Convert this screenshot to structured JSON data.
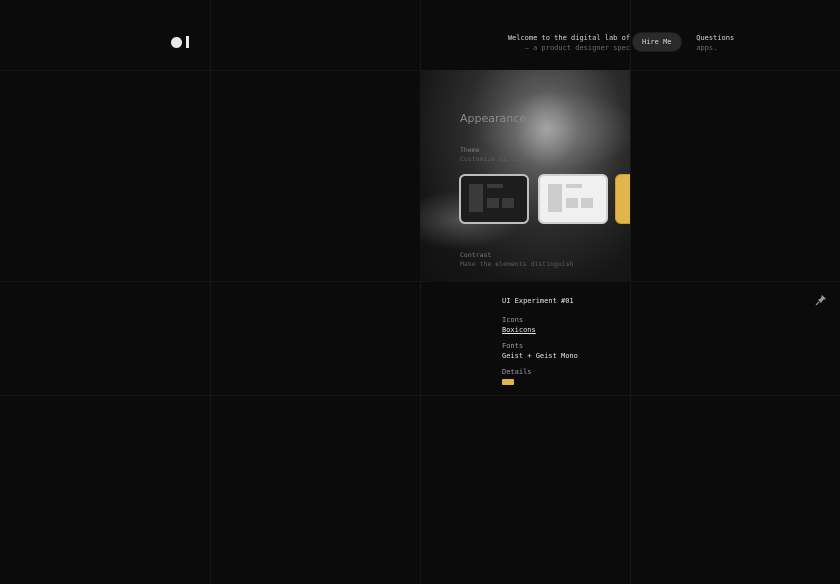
{
  "header": {
    "welcome_line1": "Welcome to the digital lab of",
    "welcome_line1_end": "Questions",
    "welcome_line2": "— a product designer spec",
    "welcome_line2_end": "apps.",
    "hire_label": "Hire Me"
  },
  "preview": {
    "title": "Appearance",
    "theme_label": "Theme",
    "theme_sub": "Customize UI colors",
    "themes": [
      "dark",
      "light",
      "yellow"
    ],
    "contrast_label": "Contrast",
    "contrast_sub": "Make the elements distinguish"
  },
  "info": {
    "experiment": "UI Experiment #01",
    "icons_label": "Icons",
    "icons_value": "Boxicons",
    "fonts_label": "Fonts",
    "fonts_value": "Geist + Geist Mono",
    "details_label": "Details"
  },
  "colors": {
    "accent": "#e2b54c",
    "background": "#0b0b0b"
  }
}
